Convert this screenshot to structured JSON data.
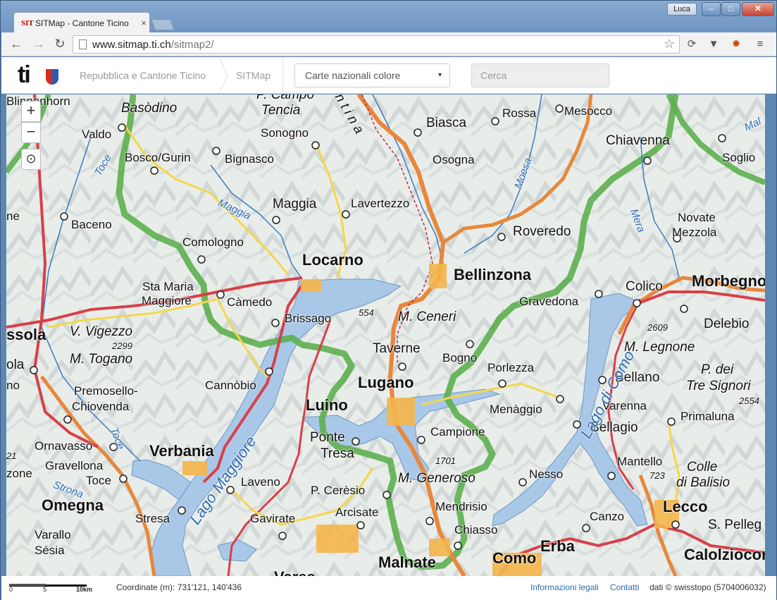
{
  "browser": {
    "tab_title": "SITMap - Cantone Ticino",
    "tab_favicon": "SIT",
    "user": "Luca",
    "url_host": "www.sitmap.ti.ch",
    "url_path": "/sitmap2/"
  },
  "header": {
    "logo_text": "ti",
    "breadcrumb": [
      "Repubblica e Cantone Ticino",
      "SITMap"
    ],
    "layer_select": "Carte nazionali colore",
    "search_placeholder": "Cerca"
  },
  "map": {
    "controls": {
      "zoom_in": "+",
      "zoom_out": "−",
      "locate": "⊙"
    },
    "labels": [
      {
        "text": "Blinnenhorn",
        "cls": "sm"
      },
      {
        "text": "Basòdino",
        "cls": "it"
      },
      {
        "text": "P. Campo",
        "cls": "it"
      },
      {
        "text": "Tencia",
        "cls": "it"
      },
      {
        "text": "Biasca",
        "cls": "med"
      },
      {
        "text": "Rossa",
        "cls": "sm"
      },
      {
        "text": "Mesocco",
        "cls": "sm"
      },
      {
        "text": "Chiavenna",
        "cls": "med"
      },
      {
        "text": "Soglio",
        "cls": "sm"
      },
      {
        "text": "Valdo",
        "cls": "sm"
      },
      {
        "text": "Sonogno",
        "cls": "sm"
      },
      {
        "text": "Bosco/Gurin",
        "cls": "sm"
      },
      {
        "text": "Bignasco",
        "cls": "sm"
      },
      {
        "text": "Osogna",
        "cls": "sm"
      },
      {
        "text": "Maggia",
        "cls": "med"
      },
      {
        "text": "Lavertezzo",
        "cls": "sm"
      },
      {
        "text": "Baceno",
        "cls": "sm"
      },
      {
        "text": "Novate",
        "cls": "sm"
      },
      {
        "text": "Mezzola",
        "cls": "sm"
      },
      {
        "text": "Roveredo",
        "cls": "med"
      },
      {
        "text": "Comologno",
        "cls": "sm"
      },
      {
        "text": "Locarno",
        "cls": "big"
      },
      {
        "text": "Bellinzona",
        "cls": "big"
      },
      {
        "text": "Colico",
        "cls": "med"
      },
      {
        "text": "Morbegno",
        "cls": "big"
      },
      {
        "text": "Sta Maria",
        "cls": "sm"
      },
      {
        "text": "Maggiore",
        "cls": "sm"
      },
      {
        "text": "Càmedo",
        "cls": "sm"
      },
      {
        "text": "Brissago",
        "cls": "sm"
      },
      {
        "text": "554",
        "cls": "alt"
      },
      {
        "text": "M. Ceneri",
        "cls": "it"
      },
      {
        "text": "Gravedona",
        "cls": "sm"
      },
      {
        "text": "Delebio",
        "cls": "med"
      },
      {
        "text": "2609",
        "cls": "alt"
      },
      {
        "text": "ssola",
        "cls": "big"
      },
      {
        "text": "V. Vigezzo",
        "cls": "it"
      },
      {
        "text": "2299",
        "cls": "alt"
      },
      {
        "text": "M. Togano",
        "cls": "it"
      },
      {
        "text": "Taverne",
        "cls": "med"
      },
      {
        "text": "Bogno",
        "cls": "sm"
      },
      {
        "text": "M. Legnone",
        "cls": "it"
      },
      {
        "text": "ola",
        "cls": "med"
      },
      {
        "text": "Cannòbio",
        "cls": "sm"
      },
      {
        "text": "Lugano",
        "cls": "big"
      },
      {
        "text": "Porlezza",
        "cls": "sm"
      },
      {
        "text": "Bellano",
        "cls": "med"
      },
      {
        "text": "P. dei",
        "cls": "it"
      },
      {
        "text": "Tre Signori",
        "cls": "it"
      },
      {
        "text": "Premosello-",
        "cls": "sm"
      },
      {
        "text": "Chiovenda",
        "cls": "sm"
      },
      {
        "text": "Luino",
        "cls": "big"
      },
      {
        "text": "Menàggio",
        "cls": "sm"
      },
      {
        "text": "Varenna",
        "cls": "sm"
      },
      {
        "text": "2554",
        "cls": "alt"
      },
      {
        "text": "Primaluna",
        "cls": "sm"
      },
      {
        "text": "Campione",
        "cls": "sm"
      },
      {
        "text": "Bellagio",
        "cls": "med"
      },
      {
        "text": "Ornavasso",
        "cls": "sm"
      },
      {
        "text": "Verbania",
        "cls": "big"
      },
      {
        "text": "Ponte",
        "cls": "med"
      },
      {
        "text": "Tresa",
        "cls": "med"
      },
      {
        "text": "1701",
        "cls": "alt"
      },
      {
        "text": "Gravellona",
        "cls": "sm"
      },
      {
        "text": "Toce",
        "cls": "sm"
      },
      {
        "text": "Nesso",
        "cls": "sm"
      },
      {
        "text": "Mantello",
        "cls": "sm"
      },
      {
        "text": "723",
        "cls": "alt"
      },
      {
        "text": "Colle",
        "cls": "it"
      },
      {
        "text": "di Balisio",
        "cls": "it"
      },
      {
        "text": "M. Generoso",
        "cls": "it"
      },
      {
        "text": "Laveno",
        "cls": "sm"
      },
      {
        "text": "P. Cerèsio",
        "cls": "sm"
      },
      {
        "text": "Omegna",
        "cls": "big"
      },
      {
        "text": "Arcisate",
        "cls": "sm"
      },
      {
        "text": "Mendrisio",
        "cls": "sm"
      },
      {
        "text": "Lecco",
        "cls": "big"
      },
      {
        "text": "Stresa",
        "cls": "sm"
      },
      {
        "text": "Canzo",
        "cls": "sm"
      },
      {
        "text": "S. Pelleg",
        "cls": "med"
      },
      {
        "text": "Gavirate",
        "cls": "sm"
      },
      {
        "text": "Chiasso",
        "cls": "sm"
      },
      {
        "text": "Varallo",
        "cls": "sm"
      },
      {
        "text": "Sésia",
        "cls": "sm"
      },
      {
        "text": "Erba",
        "cls": "big"
      },
      {
        "text": "Calolziocor",
        "cls": "big"
      },
      {
        "text": "Malnate",
        "cls": "big"
      },
      {
        "text": "Como",
        "cls": "big"
      },
      {
        "text": "Vares",
        "cls": "big"
      },
      {
        "text": "Lago Maggiore",
        "cls": "water"
      },
      {
        "text": "Lago di Como",
        "cls": "water"
      },
      {
        "text": "Maggia",
        "cls": "water"
      },
      {
        "text": "Moesa",
        "cls": "water"
      },
      {
        "text": "Mera",
        "cls": "water"
      },
      {
        "text": "Toce",
        "cls": "water"
      },
      {
        "text": "Toce",
        "cls": "water"
      },
      {
        "text": "Strona",
        "cls": "water"
      },
      {
        "text": "Mal",
        "cls": "water"
      },
      {
        "text": "ne",
        "cls": "sm"
      },
      {
        "text": "no",
        "cls": "sm"
      },
      {
        "text": "21",
        "cls": "alt"
      },
      {
        "text": "zone",
        "cls": "sm"
      },
      {
        "text": "n t i n a",
        "cls": "it"
      }
    ]
  },
  "statusbar": {
    "scale_labels": [
      "0",
      "5",
      "10km"
    ],
    "coordinates": "Coordinate (m): 731'121, 140'436",
    "link_legal": "Informazioni legali",
    "link_contacts": "Contatti",
    "credit": "dati © swisstopo (5704006032)"
  },
  "colors": {
    "lake": "#a9c8e8",
    "terrain": "#e6ebe6",
    "border_green": "#5daf4f",
    "motorway": "#e8873a",
    "road_red": "#d7404a",
    "road_yellow": "#f3d74a",
    "link_blue": "#2b6bb0"
  }
}
